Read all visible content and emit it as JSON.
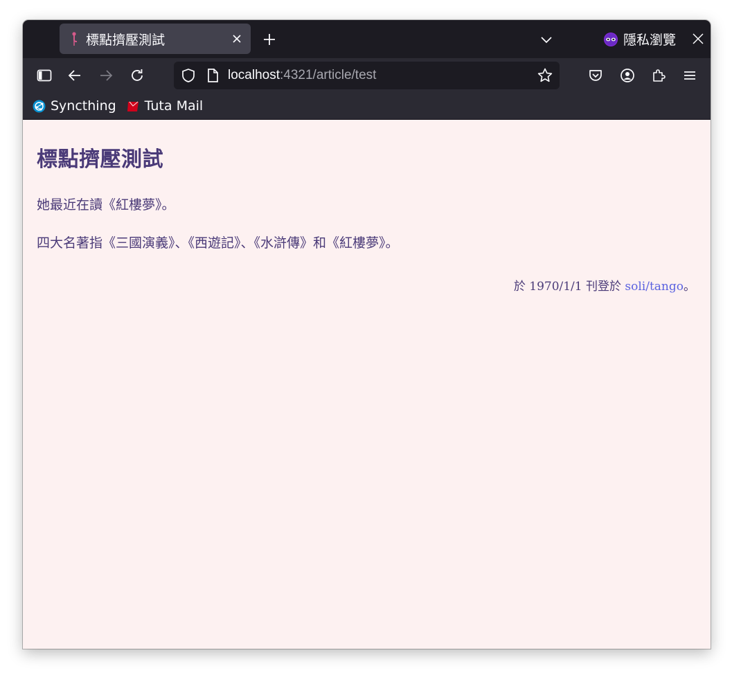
{
  "browser": {
    "tab": {
      "title": "標點擠壓測試"
    },
    "private_label": "隱私瀏覽",
    "url": {
      "host": "localhost",
      "rest": ":4321/article/test"
    },
    "bookmarks": [
      {
        "label": "Syncthing",
        "icon": "syncthing-icon"
      },
      {
        "label": "Tuta Mail",
        "icon": "tuta-mail-icon"
      }
    ],
    "colors": {
      "chrome": "#1c1b22",
      "toolbar": "#2b2a33",
      "tab_active": "#42414d",
      "page_bg": "#fdf1f1",
      "text": "#4a3a78",
      "link": "#5b62e0"
    }
  },
  "article": {
    "title": "標點擠壓測試",
    "paragraphs": [
      "她最近在讀《紅樓夢》。",
      "四大名著指《三國演義》、《西遊記》、《水滸傳》和《紅樓夢》。"
    ],
    "byline": {
      "prefix": "於 1970/1/1 刊登於 ",
      "link": "soli/tango",
      "suffix": "。"
    }
  }
}
